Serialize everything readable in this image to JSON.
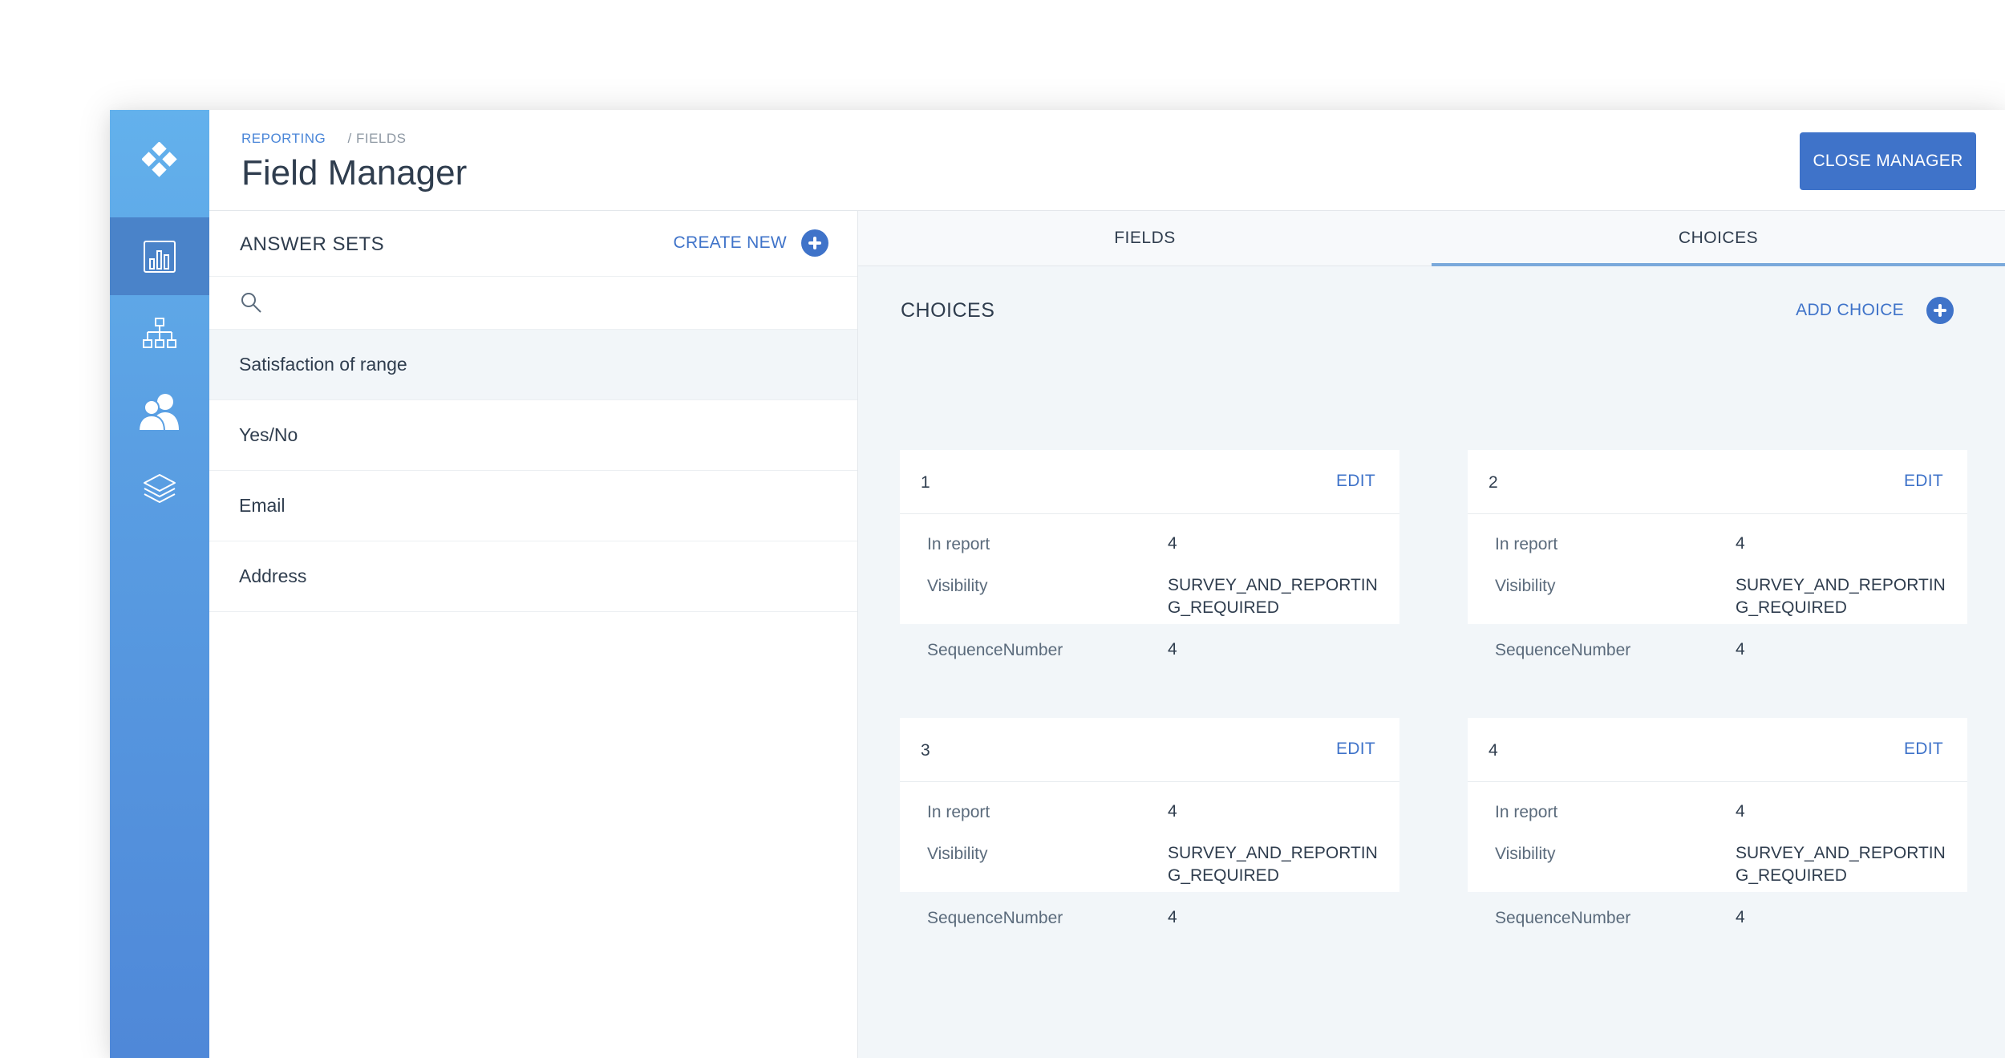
{
  "breadcrumb": {
    "parent": "REPORTING",
    "separator": "/",
    "current": "FIELDS"
  },
  "header": {
    "title": "Field Manager",
    "close_label": "CLOSE MANAGER"
  },
  "sidebar": {
    "logo_icon": "diamond-logo-icon",
    "items": [
      {
        "icon": "bar-chart-icon",
        "active": true
      },
      {
        "icon": "hierarchy-icon",
        "active": false
      },
      {
        "icon": "users-icon",
        "active": false
      },
      {
        "icon": "layers-icon",
        "active": false
      }
    ]
  },
  "answer_sets": {
    "title": "ANSWER SETS",
    "create_label": "CREATE NEW",
    "search_placeholder": "",
    "items": [
      "Satisfaction of range",
      "Yes/No",
      "Email",
      "Address"
    ]
  },
  "tabs": [
    "FIELDS",
    "CHOICES"
  ],
  "choices": {
    "title": "CHOICES",
    "add_label": "ADD CHOICE",
    "edit_label": "EDIT",
    "row_labels": {
      "in_report": "In report",
      "visibility": "Visibility",
      "sequence": "SequenceNumber"
    },
    "cards": [
      {
        "number": "1",
        "in_report": "4",
        "visibility": "SURVEY_AND_REPORTING_REQUIRED",
        "sequence": "4"
      },
      {
        "number": "2",
        "in_report": "4",
        "visibility": "SURVEY_AND_REPORTING_REQUIRED",
        "sequence": "4"
      },
      {
        "number": "3",
        "in_report": "4",
        "visibility": "SURVEY_AND_REPORTING_REQUIRED",
        "sequence": "4"
      },
      {
        "number": "4",
        "in_report": "4",
        "visibility": "SURVEY_AND_REPORTING_REQUIRED",
        "sequence": "4"
      }
    ]
  },
  "colors": {
    "accent": "#3f73c9",
    "sidebar_top": "#63b1ec",
    "sidebar_bottom": "#4f88d8",
    "panel_bg": "#f2f6f9"
  }
}
